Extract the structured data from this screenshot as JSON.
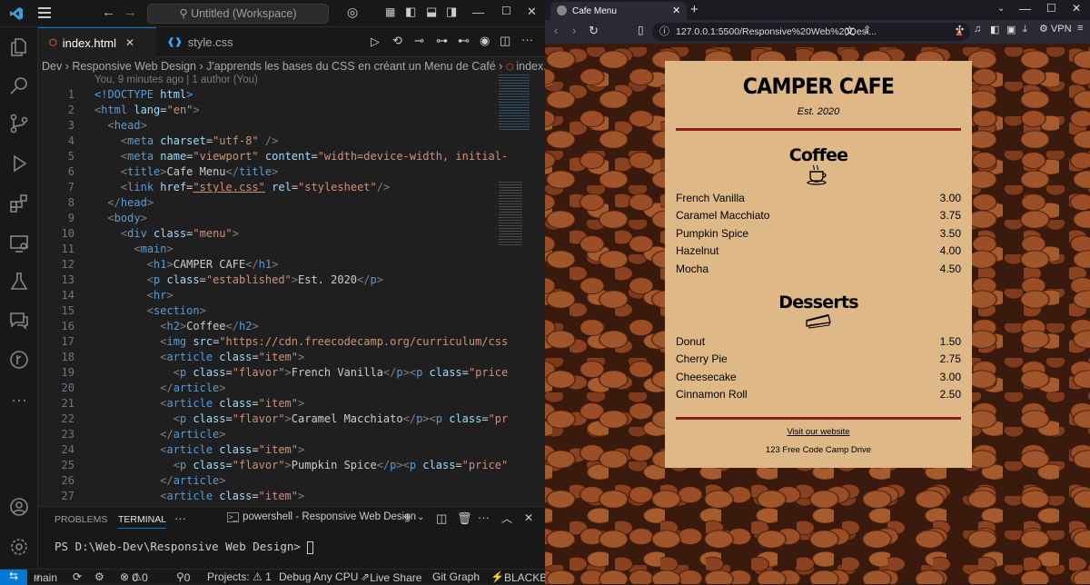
{
  "vscode": {
    "search": "Untitled (Workspace)",
    "tabs": [
      {
        "label": "index.html"
      },
      {
        "label": "style.css"
      }
    ],
    "breadcrumb": [
      "Dev",
      "Responsive Web Design",
      "J'apprends les bases du CSS en créant un Menu de Café",
      "index.html"
    ],
    "blame": "You, 9 minutes ago | 1 author (You)",
    "line_numbers": [
      "1",
      "2",
      "3",
      "4",
      "5",
      "6",
      "7",
      "8",
      "9",
      "10",
      "11",
      "12",
      "13",
      "14",
      "15",
      "16",
      "17",
      "18",
      "19",
      "20",
      "21",
      "22",
      "23",
      "24",
      "25",
      "26",
      "27"
    ],
    "panel": {
      "tabs": [
        "PROBLEMS",
        "TERMINAL"
      ],
      "terminal_name": "powershell - Responsive Web Design",
      "prompt": "PS D:\\Web-Dev\\Responsive Web Design>"
    },
    "status": {
      "branch": "main",
      "errors": "0",
      "warnings": "0",
      "ports": "0",
      "projects": "Projects: ⚠ 1",
      "debug": "Debug Any CPU",
      "live_share": "Live Share",
      "git_graph": "Git Graph",
      "blackbox": "BLACKBO"
    }
  },
  "browser": {
    "tab_title": "Cafe Menu",
    "url": "127.0.0.1:5500/Responsive%20Web%20Desi...",
    "vpn": "VPN"
  },
  "menu": {
    "title": "CAMPER CAFE",
    "established": "Est. 2020",
    "coffee_heading": "Coffee",
    "coffee_items": [
      {
        "flavor": "French Vanilla",
        "price": "3.00"
      },
      {
        "flavor": "Caramel Macchiato",
        "price": "3.75"
      },
      {
        "flavor": "Pumpkin Spice",
        "price": "3.50"
      },
      {
        "flavor": "Hazelnut",
        "price": "4.00"
      },
      {
        "flavor": "Mocha",
        "price": "4.50"
      }
    ],
    "desserts_heading": "Desserts",
    "dessert_items": [
      {
        "dessert": "Donut",
        "price": "1.50"
      },
      {
        "dessert": "Cherry Pie",
        "price": "2.75"
      },
      {
        "dessert": "Cheesecake",
        "price": "3.00"
      },
      {
        "dessert": "Cinnamon Roll",
        "price": "2.50"
      }
    ],
    "link": "Visit our website",
    "address": "123 Free Code Camp Drive"
  },
  "colors": {
    "accent": "#0078d4",
    "menu_bg": "#deb887",
    "rule": "#8b1f1f"
  }
}
